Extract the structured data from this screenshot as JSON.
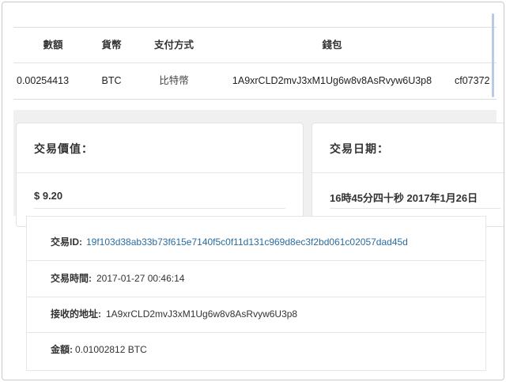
{
  "table": {
    "headers": [
      "數額",
      "貨幣",
      "支付方式",
      "錢包",
      ""
    ],
    "row": {
      "amount": "0.00254413",
      "currency": "BTC",
      "payment_method": "比特幣",
      "wallet": "1A9xrCLD2mvJ3xM1Ug6w8v8AsRvyw6U3p8",
      "txid_partial": "cf07372"
    }
  },
  "cards": {
    "value": {
      "title": "交易價值：",
      "amount": "$ 9.20"
    },
    "date": {
      "title": "交易日期：",
      "text": "16時45分四十秒 2017年1月26日"
    }
  },
  "details": {
    "tx_id": {
      "label": "交易ID:",
      "value": "19f103d38ab33b73f615e7140f5c0f11d131c969d8ec3f2bd061c02057dad45d"
    },
    "tx_time": {
      "label": "交易時間:",
      "value": "2017-01-27 00:46:14"
    },
    "recv_addr": {
      "label": "接收的地址:",
      "value": "1A9xrCLD2mvJ3xM1Ug6w8v8AsRvyw6U3p8"
    },
    "amount": {
      "label": "金額:",
      "value": "0.01002812 BTC"
    }
  },
  "colors": {
    "link": "#2b6c9e",
    "backdrop": "#f0f0f0"
  }
}
